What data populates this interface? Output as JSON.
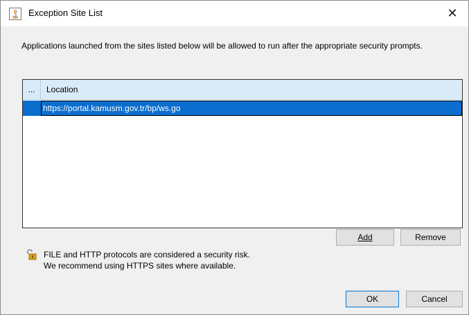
{
  "window": {
    "title": "Exception Site List",
    "close_glyph": "✕"
  },
  "description": "Applications launched from the sites listed below will be allowed to run after the appropriate security prompts.",
  "table": {
    "columns": [
      "...",
      "Location"
    ],
    "rows": [
      {
        "location": "https://portal.kamusm.gov.tr/bp/ws.go",
        "selected": true
      }
    ]
  },
  "buttons": {
    "add": "Add",
    "remove": "Remove",
    "ok": "OK",
    "cancel": "Cancel"
  },
  "warning": {
    "line1": "FILE and HTTP protocols are considered a security risk.",
    "line2": "We recommend using HTTPS sites where available."
  },
  "icons": {
    "app": "java-icon",
    "warning": "unlocked-padlock-icon"
  },
  "colors": {
    "selection": "#0b6ecf",
    "header": "#d9eaf8",
    "default_button_border": "#0078d7"
  }
}
